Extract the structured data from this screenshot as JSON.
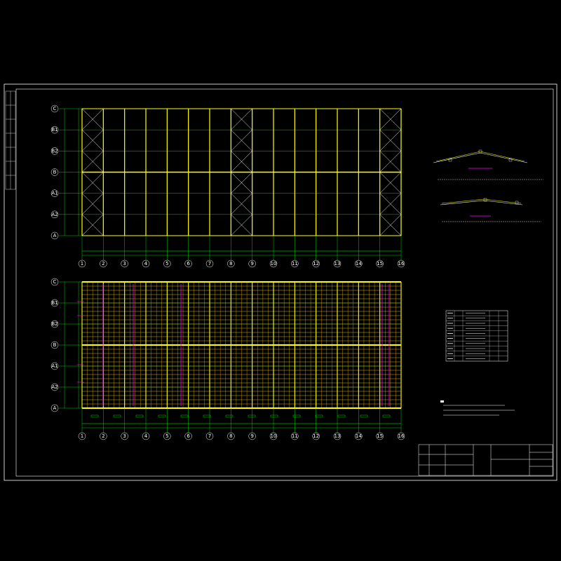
{
  "drawing": {
    "grid_columns": [
      "1",
      "2",
      "3",
      "4",
      "5",
      "6",
      "7",
      "8",
      "9",
      "10",
      "11",
      "12",
      "13",
      "14",
      "15",
      "16"
    ],
    "grid_rows_top_to_bottom": [
      "C",
      "B1",
      "B2",
      "B",
      "A1",
      "A2",
      "A"
    ],
    "plan_upper_title": "",
    "plan_lower_title": ""
  },
  "colors": {
    "background": "#000000",
    "frame": "#ffffff",
    "grid": "#00ff00",
    "rafter": "#ffff00",
    "purlin": "#d4b000",
    "bracing": "#ffffff",
    "magenta": "#ff00ff",
    "column": "#ffffff"
  }
}
